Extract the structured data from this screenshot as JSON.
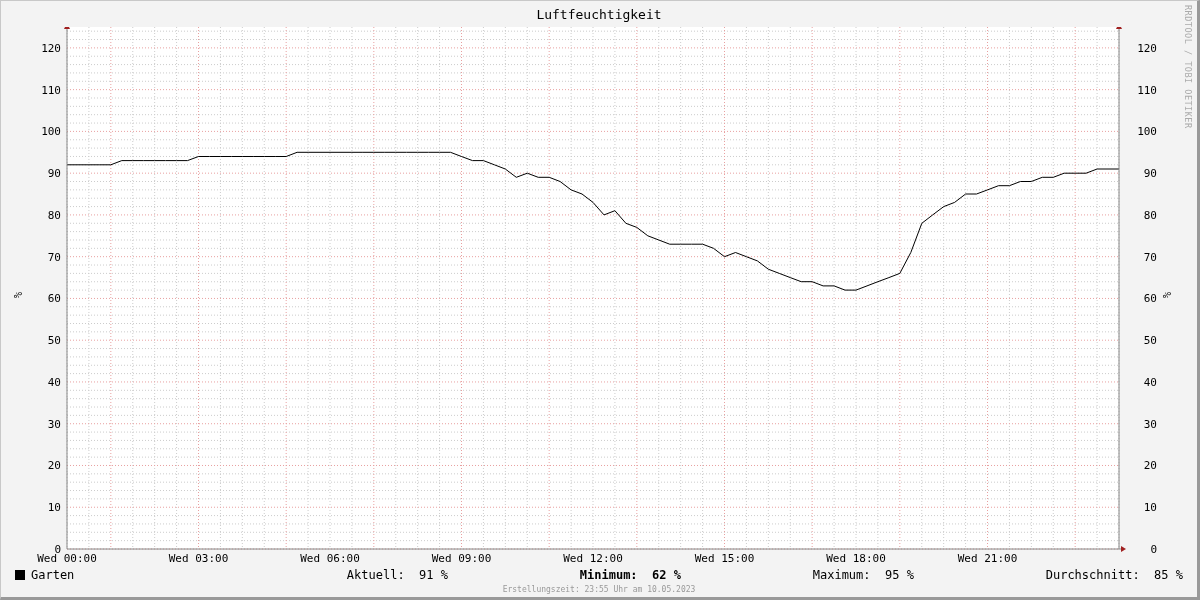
{
  "credit": "RRDTOOL / TOBI OETIKER",
  "chart": {
    "chart_data": {
      "type": "line",
      "title": "Luftfeuchtigkeit",
      "ylabel": "%",
      "categories": [
        "Wed 00:00",
        null,
        null,
        null,
        null,
        null,
        null,
        null,
        null,
        null,
        null,
        null,
        "Wed 03:00",
        null,
        null,
        null,
        null,
        null,
        null,
        null,
        null,
        null,
        null,
        null,
        "Wed 06:00",
        null,
        null,
        null,
        null,
        null,
        null,
        null,
        null,
        null,
        null,
        null,
        "Wed 09:00",
        null,
        null,
        null,
        null,
        null,
        null,
        null,
        null,
        null,
        null,
        null,
        "Wed 12:00",
        null,
        null,
        null,
        null,
        null,
        null,
        null,
        null,
        null,
        null,
        null,
        "Wed 15:00",
        null,
        null,
        null,
        null,
        null,
        null,
        null,
        null,
        null,
        null,
        null,
        "Wed 18:00",
        null,
        null,
        null,
        null,
        null,
        null,
        null,
        null,
        null,
        null,
        null,
        "Wed 21:00",
        null,
        null,
        null,
        null,
        null,
        null,
        null,
        null,
        null,
        null,
        null,
        null
      ],
      "series": [
        {
          "name": "Garten",
          "color": "#000000",
          "values": [
            92,
            92,
            92,
            92,
            92,
            93,
            93,
            93,
            93,
            93,
            93,
            93,
            94,
            94,
            94,
            94,
            94,
            94,
            94,
            94,
            94,
            95,
            95,
            95,
            95,
            95,
            95,
            95,
            95,
            95,
            95,
            95,
            95,
            95,
            95,
            95,
            94,
            93,
            93,
            92,
            91,
            89,
            90,
            89,
            89,
            88,
            86,
            85,
            83,
            80,
            81,
            78,
            77,
            75,
            74,
            73,
            73,
            73,
            73,
            72,
            70,
            71,
            70,
            69,
            67,
            66,
            65,
            64,
            64,
            63,
            63,
            62,
            62,
            63,
            64,
            65,
            66,
            71,
            78,
            80,
            82,
            83,
            85,
            85,
            86,
            87,
            87,
            88,
            88,
            89,
            89,
            90,
            90,
            90,
            91,
            91,
            91
          ]
        }
      ],
      "ylim": [
        0,
        125
      ],
      "grid": true,
      "yticks": [
        0,
        10,
        20,
        30,
        40,
        50,
        60,
        70,
        80,
        90,
        100,
        110,
        120
      ]
    },
    "right_yticks": [
      "120",
      "110",
      "100",
      "90",
      "80",
      "70",
      "60",
      "50",
      "40",
      "30",
      "20",
      "10",
      "0"
    ],
    "right_axis_label": "%"
  },
  "legend": {
    "color": "#000000",
    "stats": [
      {
        "label": "Aktuell:",
        "value": "91 %",
        "bold": false
      },
      {
        "label": "Minimum:",
        "value": "62 %",
        "bold": true
      },
      {
        "label": "Maximum:",
        "value": "95 %",
        "bold": false
      },
      {
        "label": "Durchschnitt:",
        "value": "85 %",
        "bold": false
      }
    ]
  },
  "footer": "Erstellungszeit: 23:55 Uhr am 10.05.2023"
}
